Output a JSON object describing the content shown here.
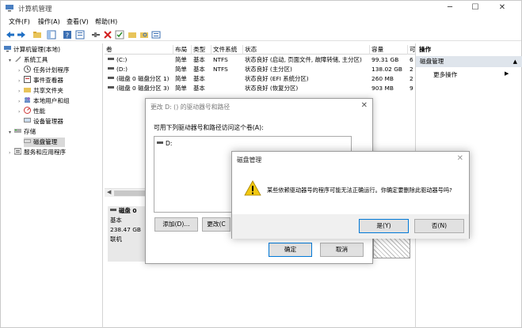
{
  "window": {
    "title": "计算机管理"
  },
  "menu": [
    "文件(F)",
    "操作(A)",
    "查看(V)",
    "帮助(H)"
  ],
  "tree": {
    "root": "计算机管理(本地)",
    "system_tools": "系统工具",
    "task_scheduler": "任务计划程序",
    "event_viewer": "事件查看器",
    "shared_folders": "共享文件夹",
    "local_users": "本地用户和组",
    "performance": "性能",
    "device_manager": "设备管理器",
    "storage": "存储",
    "disk_management": "磁盘管理",
    "services_apps": "服务和应用程序"
  },
  "volumes": {
    "headers": [
      "卷",
      "布局",
      "类型",
      "文件系统",
      "状态",
      "容量",
      "可"
    ],
    "rows": [
      [
        "(C:)",
        "简单",
        "基本",
        "NTFS",
        "状态良好 (启动, 页面文件, 故障转储, 主分区)",
        "99.31 GB",
        "6"
      ],
      [
        "(D:)",
        "简单",
        "基本",
        "NTFS",
        "状态良好 (主分区)",
        "138.02 GB",
        "2"
      ],
      [
        "(磁盘 0 磁盘分区 1)",
        "简单",
        "基本",
        "",
        "状态良好 (EFI 系统分区)",
        "260 MB",
        "2"
      ],
      [
        "(磁盘 0 磁盘分区 3)",
        "简单",
        "基本",
        "",
        "状态良好 (恢复分区)",
        "903 MB",
        "9"
      ]
    ]
  },
  "disk": {
    "name": "磁盘 0",
    "type": "基本",
    "size": "238.47 GB",
    "status": "联机"
  },
  "actions": {
    "header": "操作",
    "section": "磁盘管理",
    "more": "更多操作"
  },
  "dialog_change": {
    "title": "更改 D: () 的驱动器号和路径",
    "prompt": "可用下列驱动器号和路径访问这个卷(A):",
    "item": "D:",
    "add": "添加(D)...",
    "change": "更改(C",
    "ok": "确定",
    "cancel": "取消"
  },
  "dialog_confirm": {
    "title": "磁盘管理",
    "message": "某些依赖驱动器号的程序可能无法正确运行。你确定要删除此驱动器号吗?",
    "yes": "是(Y)",
    "no": "否(N)"
  },
  "colors": {
    "accent": "#0078d7",
    "warning": "#f2c811",
    "selection": "#d9d9d9"
  }
}
